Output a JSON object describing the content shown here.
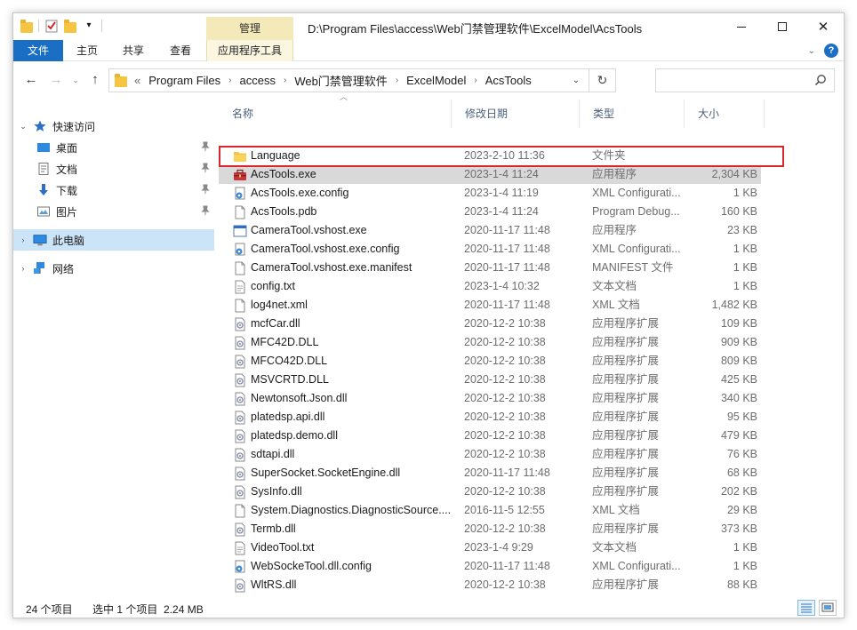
{
  "window": {
    "title": "D:\\Program Files\\access\\Web门禁管理软件\\ExcelModel\\AcsTools",
    "context_tab": "管理"
  },
  "ribbon": {
    "tabs": [
      "文件",
      "主页",
      "共享",
      "查看",
      "应用程序工具"
    ],
    "help": "?"
  },
  "address": {
    "overflow": "«",
    "segments": [
      "Program Files",
      "access",
      "Web门禁管理软件",
      "ExcelModel",
      "AcsTools"
    ],
    "search_placeholder": ""
  },
  "sidebar": {
    "items": [
      {
        "label": "快速访问",
        "icon": "star-icon",
        "level": 0,
        "expanded": true
      },
      {
        "label": "桌面",
        "icon": "desktop-icon",
        "level": 1,
        "pinned": true
      },
      {
        "label": "文档",
        "icon": "document-icon",
        "level": 1,
        "pinned": true
      },
      {
        "label": "下载",
        "icon": "download-icon",
        "level": 1,
        "pinned": true
      },
      {
        "label": "图片",
        "icon": "pictures-icon",
        "level": 1,
        "pinned": true
      },
      {
        "label": "此电脑",
        "icon": "computer-icon",
        "level": 0,
        "selected": true
      },
      {
        "label": "网络",
        "icon": "network-icon",
        "level": 0
      }
    ]
  },
  "columns": {
    "name": "名称",
    "date": "修改日期",
    "type": "类型",
    "size": "大小"
  },
  "files": [
    {
      "name": "Language",
      "date": "2023-2-10 11:36",
      "type": "文件夹",
      "size": "",
      "icon": "folder-icon"
    },
    {
      "name": "AcsTools.exe",
      "date": "2023-1-4 11:24",
      "type": "应用程序",
      "size": "2,304 KB",
      "icon": "toolbox-exe-icon",
      "selected": true
    },
    {
      "name": "AcsTools.exe.config",
      "date": "2023-1-4 11:19",
      "type": "XML Configurati...",
      "size": "1 KB",
      "icon": "config-icon"
    },
    {
      "name": "AcsTools.pdb",
      "date": "2023-1-4 11:24",
      "type": "Program Debug...",
      "size": "160 KB",
      "icon": "file-icon"
    },
    {
      "name": "CameraTool.vshost.exe",
      "date": "2020-11-17 11:48",
      "type": "应用程序",
      "size": "23 KB",
      "icon": "exe-icon"
    },
    {
      "name": "CameraTool.vshost.exe.config",
      "date": "2020-11-17 11:48",
      "type": "XML Configurati...",
      "size": "1 KB",
      "icon": "config-icon"
    },
    {
      "name": "CameraTool.vshost.exe.manifest",
      "date": "2020-11-17 11:48",
      "type": "MANIFEST 文件",
      "size": "1 KB",
      "icon": "file-icon"
    },
    {
      "name": "config.txt",
      "date": "2023-1-4 10:32",
      "type": "文本文档",
      "size": "1 KB",
      "icon": "text-file-icon"
    },
    {
      "name": "log4net.xml",
      "date": "2020-11-17 11:48",
      "type": "XML 文档",
      "size": "1,482 KB",
      "icon": "file-icon"
    },
    {
      "name": "mcfCar.dll",
      "date": "2020-12-2 10:38",
      "type": "应用程序扩展",
      "size": "109 KB",
      "icon": "dll-icon"
    },
    {
      "name": "MFC42D.DLL",
      "date": "2020-12-2 10:38",
      "type": "应用程序扩展",
      "size": "909 KB",
      "icon": "dll-icon"
    },
    {
      "name": "MFCO42D.DLL",
      "date": "2020-12-2 10:38",
      "type": "应用程序扩展",
      "size": "809 KB",
      "icon": "dll-icon"
    },
    {
      "name": "MSVCRTD.DLL",
      "date": "2020-12-2 10:38",
      "type": "应用程序扩展",
      "size": "425 KB",
      "icon": "dll-icon"
    },
    {
      "name": "Newtonsoft.Json.dll",
      "date": "2020-12-2 10:38",
      "type": "应用程序扩展",
      "size": "340 KB",
      "icon": "dll-icon"
    },
    {
      "name": "platedsp.api.dll",
      "date": "2020-12-2 10:38",
      "type": "应用程序扩展",
      "size": "95 KB",
      "icon": "dll-icon"
    },
    {
      "name": "platedsp.demo.dll",
      "date": "2020-12-2 10:38",
      "type": "应用程序扩展",
      "size": "479 KB",
      "icon": "dll-icon"
    },
    {
      "name": "sdtapi.dll",
      "date": "2020-12-2 10:38",
      "type": "应用程序扩展",
      "size": "76 KB",
      "icon": "dll-icon"
    },
    {
      "name": "SuperSocket.SocketEngine.dll",
      "date": "2020-11-17 11:48",
      "type": "应用程序扩展",
      "size": "68 KB",
      "icon": "dll-icon"
    },
    {
      "name": "SysInfo.dll",
      "date": "2020-12-2 10:38",
      "type": "应用程序扩展",
      "size": "202 KB",
      "icon": "dll-icon"
    },
    {
      "name": "System.Diagnostics.DiagnosticSource....",
      "date": "2016-11-5 12:55",
      "type": "XML 文档",
      "size": "29 KB",
      "icon": "file-icon"
    },
    {
      "name": "Termb.dll",
      "date": "2020-12-2 10:38",
      "type": "应用程序扩展",
      "size": "373 KB",
      "icon": "dll-icon"
    },
    {
      "name": "VideoTool.txt",
      "date": "2023-1-4 9:29",
      "type": "文本文档",
      "size": "1 KB",
      "icon": "text-file-icon"
    },
    {
      "name": "WebSockeTool.dll.config",
      "date": "2020-11-17 11:48",
      "type": "XML Configurati...",
      "size": "1 KB",
      "icon": "config-icon"
    },
    {
      "name": "WltRS.dll",
      "date": "2020-12-2 10:38",
      "type": "应用程序扩展",
      "size": "88 KB",
      "icon": "dll-icon"
    }
  ],
  "status": {
    "item_count": "24 个项目",
    "selection": "选中 1 个项目  2.24 MB"
  },
  "colors": {
    "accent": "#1a6fc4",
    "selection": "#d9d9d9",
    "nav_selected": "#cce4f7",
    "highlight_border": "#d9262c",
    "manage_tab": "#f4e9b8"
  }
}
